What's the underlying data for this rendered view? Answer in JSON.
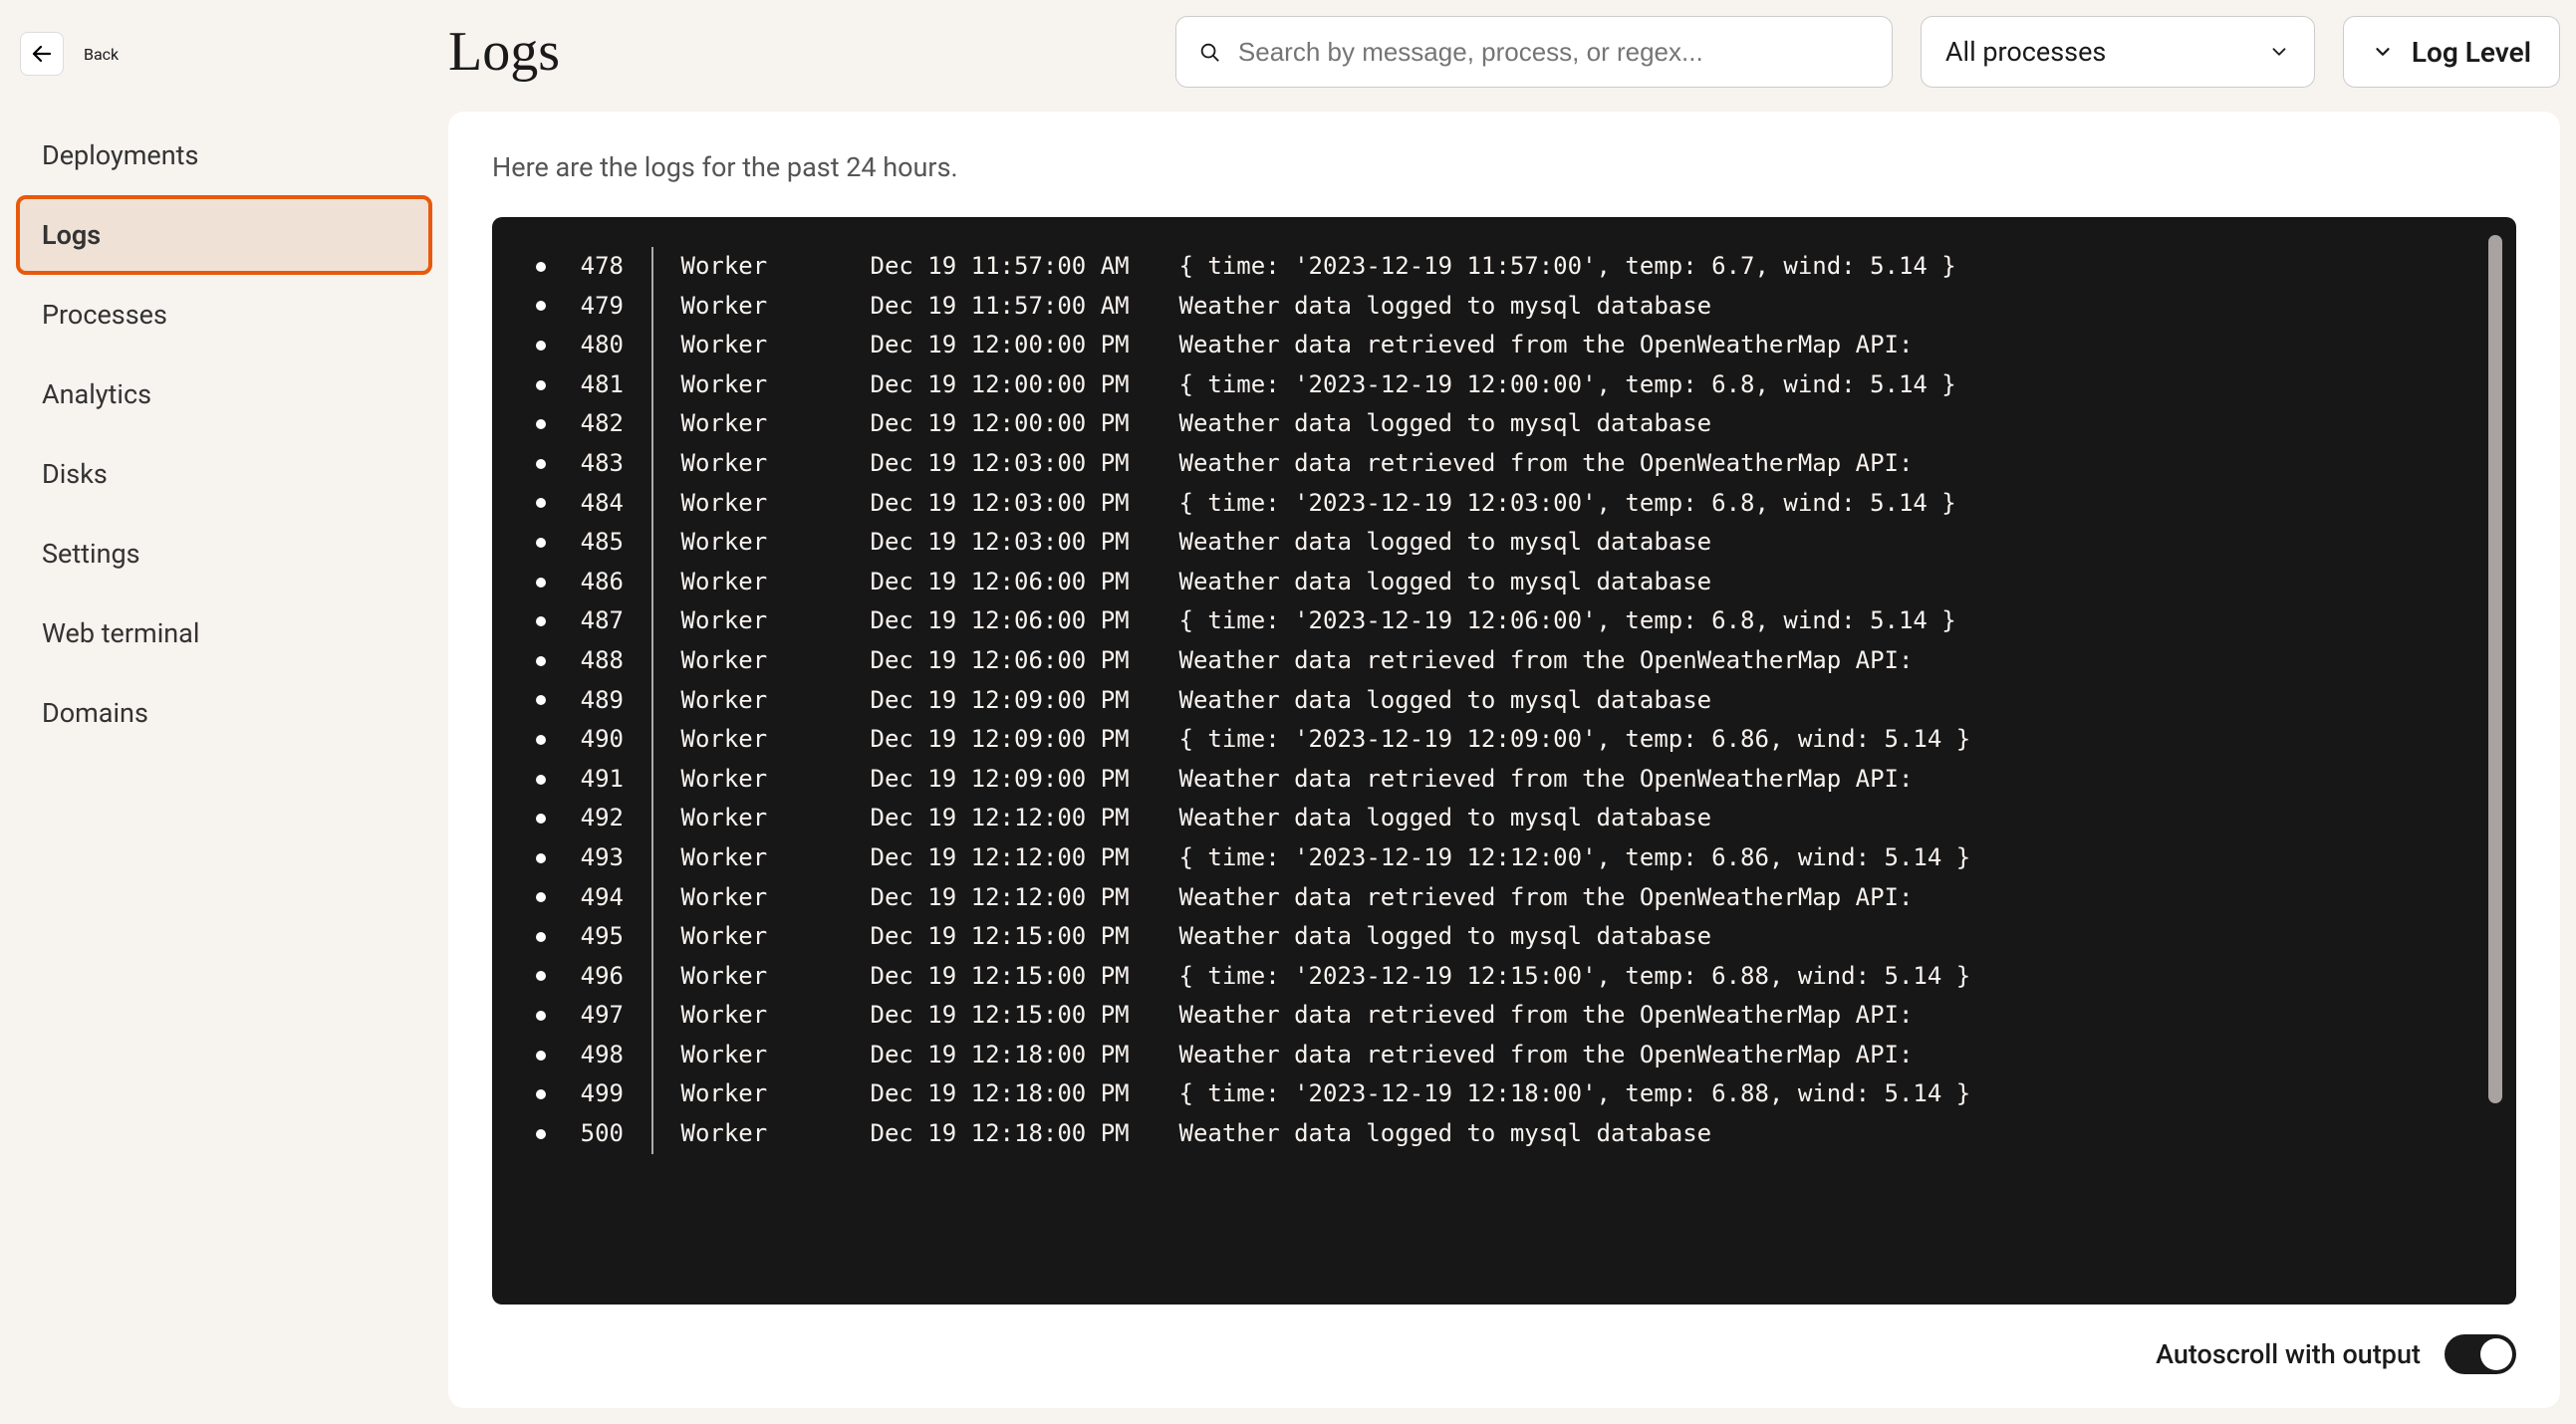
{
  "back": "Back",
  "title": "Logs",
  "search": {
    "placeholder": "Search by message, process, or regex..."
  },
  "processFilter": {
    "selected": "All processes"
  },
  "logLevel": {
    "label": "Log Level"
  },
  "sidebar": {
    "items": [
      {
        "label": "Deployments"
      },
      {
        "label": "Logs"
      },
      {
        "label": "Processes"
      },
      {
        "label": "Analytics"
      },
      {
        "label": "Disks"
      },
      {
        "label": "Settings"
      },
      {
        "label": "Web terminal"
      },
      {
        "label": "Domains"
      }
    ]
  },
  "panel": {
    "desc": "Here are the logs for the past 24 hours."
  },
  "footer": {
    "autoscroll": "Autoscroll with output"
  },
  "logs": [
    {
      "n": "478",
      "proc": "Worker",
      "ts": "Dec 19 11:57:00 AM",
      "msg": "{ time: '2023-12-19 11:57:00', temp: 6.7, wind: 5.14 }"
    },
    {
      "n": "479",
      "proc": "Worker",
      "ts": "Dec 19 11:57:00 AM",
      "msg": "Weather data logged to mysql database"
    },
    {
      "n": "480",
      "proc": "Worker",
      "ts": "Dec 19 12:00:00 PM",
      "msg": "Weather data retrieved from the OpenWeatherMap API:"
    },
    {
      "n": "481",
      "proc": "Worker",
      "ts": "Dec 19 12:00:00 PM",
      "msg": "{ time: '2023-12-19 12:00:00', temp: 6.8, wind: 5.14 }"
    },
    {
      "n": "482",
      "proc": "Worker",
      "ts": "Dec 19 12:00:00 PM",
      "msg": "Weather data logged to mysql database"
    },
    {
      "n": "483",
      "proc": "Worker",
      "ts": "Dec 19 12:03:00 PM",
      "msg": "Weather data retrieved from the OpenWeatherMap API:"
    },
    {
      "n": "484",
      "proc": "Worker",
      "ts": "Dec 19 12:03:00 PM",
      "msg": "{ time: '2023-12-19 12:03:00', temp: 6.8, wind: 5.14 }"
    },
    {
      "n": "485",
      "proc": "Worker",
      "ts": "Dec 19 12:03:00 PM",
      "msg": "Weather data logged to mysql database"
    },
    {
      "n": "486",
      "proc": "Worker",
      "ts": "Dec 19 12:06:00 PM",
      "msg": "Weather data logged to mysql database"
    },
    {
      "n": "487",
      "proc": "Worker",
      "ts": "Dec 19 12:06:00 PM",
      "msg": "{ time: '2023-12-19 12:06:00', temp: 6.8, wind: 5.14 }"
    },
    {
      "n": "488",
      "proc": "Worker",
      "ts": "Dec 19 12:06:00 PM",
      "msg": "Weather data retrieved from the OpenWeatherMap API:"
    },
    {
      "n": "489",
      "proc": "Worker",
      "ts": "Dec 19 12:09:00 PM",
      "msg": "Weather data logged to mysql database"
    },
    {
      "n": "490",
      "proc": "Worker",
      "ts": "Dec 19 12:09:00 PM",
      "msg": "{ time: '2023-12-19 12:09:00', temp: 6.86, wind: 5.14 }"
    },
    {
      "n": "491",
      "proc": "Worker",
      "ts": "Dec 19 12:09:00 PM",
      "msg": "Weather data retrieved from the OpenWeatherMap API:"
    },
    {
      "n": "492",
      "proc": "Worker",
      "ts": "Dec 19 12:12:00 PM",
      "msg": "Weather data logged to mysql database"
    },
    {
      "n": "493",
      "proc": "Worker",
      "ts": "Dec 19 12:12:00 PM",
      "msg": "{ time: '2023-12-19 12:12:00', temp: 6.86, wind: 5.14 }"
    },
    {
      "n": "494",
      "proc": "Worker",
      "ts": "Dec 19 12:12:00 PM",
      "msg": "Weather data retrieved from the OpenWeatherMap API:"
    },
    {
      "n": "495",
      "proc": "Worker",
      "ts": "Dec 19 12:15:00 PM",
      "msg": "Weather data logged to mysql database"
    },
    {
      "n": "496",
      "proc": "Worker",
      "ts": "Dec 19 12:15:00 PM",
      "msg": "{ time: '2023-12-19 12:15:00', temp: 6.88, wind: 5.14 }"
    },
    {
      "n": "497",
      "proc": "Worker",
      "ts": "Dec 19 12:15:00 PM",
      "msg": "Weather data retrieved from the OpenWeatherMap API:"
    },
    {
      "n": "498",
      "proc": "Worker",
      "ts": "Dec 19 12:18:00 PM",
      "msg": "Weather data retrieved from the OpenWeatherMap API:"
    },
    {
      "n": "499",
      "proc": "Worker",
      "ts": "Dec 19 12:18:00 PM",
      "msg": "{ time: '2023-12-19 12:18:00', temp: 6.88, wind: 5.14 }"
    },
    {
      "n": "500",
      "proc": "Worker",
      "ts": "Dec 19 12:18:00 PM",
      "msg": "Weather data logged to mysql database"
    }
  ]
}
